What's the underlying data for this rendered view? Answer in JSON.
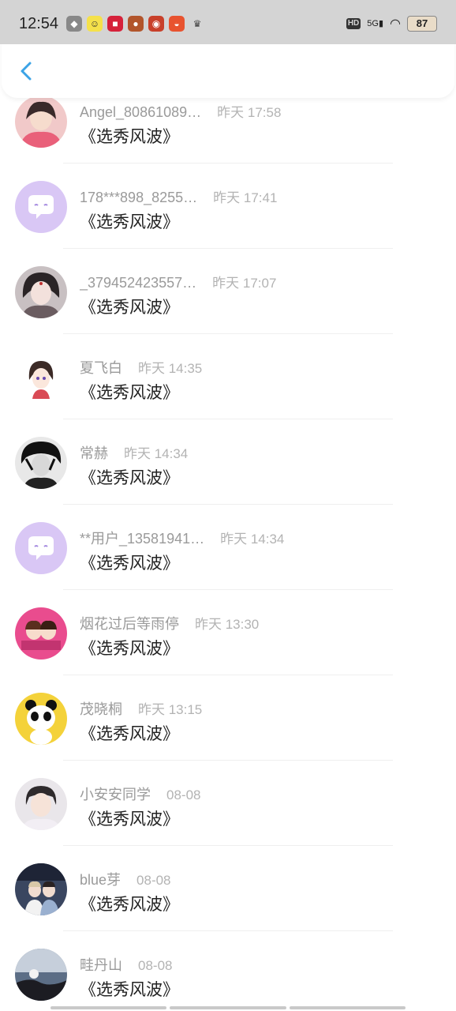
{
  "status_bar": {
    "time": "12:54",
    "network": "5G",
    "hd": "HD",
    "battery": "87"
  },
  "header": {
    "back_icon": "chevron-left-icon",
    "accent_color": "#3ba3e6"
  },
  "comments": [
    {
      "name": "Angel_80861089…",
      "time": "昨天 17:58",
      "text": "《选秀风波》",
      "avatar": "pink-girl"
    },
    {
      "name": "178***898_8255…",
      "time": "昨天 17:41",
      "text": "《选秀风波》",
      "avatar": "default-purple"
    },
    {
      "name": "_379452423557…",
      "time": "昨天 17:07",
      "text": "《选秀风波》",
      "avatar": "ancient-girl"
    },
    {
      "name": "夏飞白",
      "time": "昨天 14:35",
      "text": "《选秀风波》",
      "avatar": "anime-girl"
    },
    {
      "name": "常赫",
      "time": "昨天 14:34",
      "text": "《选秀风波》",
      "avatar": "dark-boy"
    },
    {
      "name": "**用户_13581941…",
      "time": "昨天 14:34",
      "text": "《选秀风波》",
      "avatar": "default-purple"
    },
    {
      "name": "烟花过后等雨停",
      "time": "昨天 13:30",
      "text": "《选秀风波》",
      "avatar": "pink-couple"
    },
    {
      "name": "茂晓桐",
      "time": "昨天 13:15",
      "text": "《选秀风波》",
      "avatar": "panda"
    },
    {
      "name": "小安安同学",
      "time": "08-08",
      "text": "《选秀风波》",
      "avatar": "boy-photo"
    },
    {
      "name": "blue芽",
      "time": "08-08",
      "text": "《选秀风波》",
      "avatar": "blue-photo"
    },
    {
      "name": "畦丹山",
      "time": "08-08",
      "text": "《选秀风波》",
      "avatar": "silhouette"
    }
  ]
}
